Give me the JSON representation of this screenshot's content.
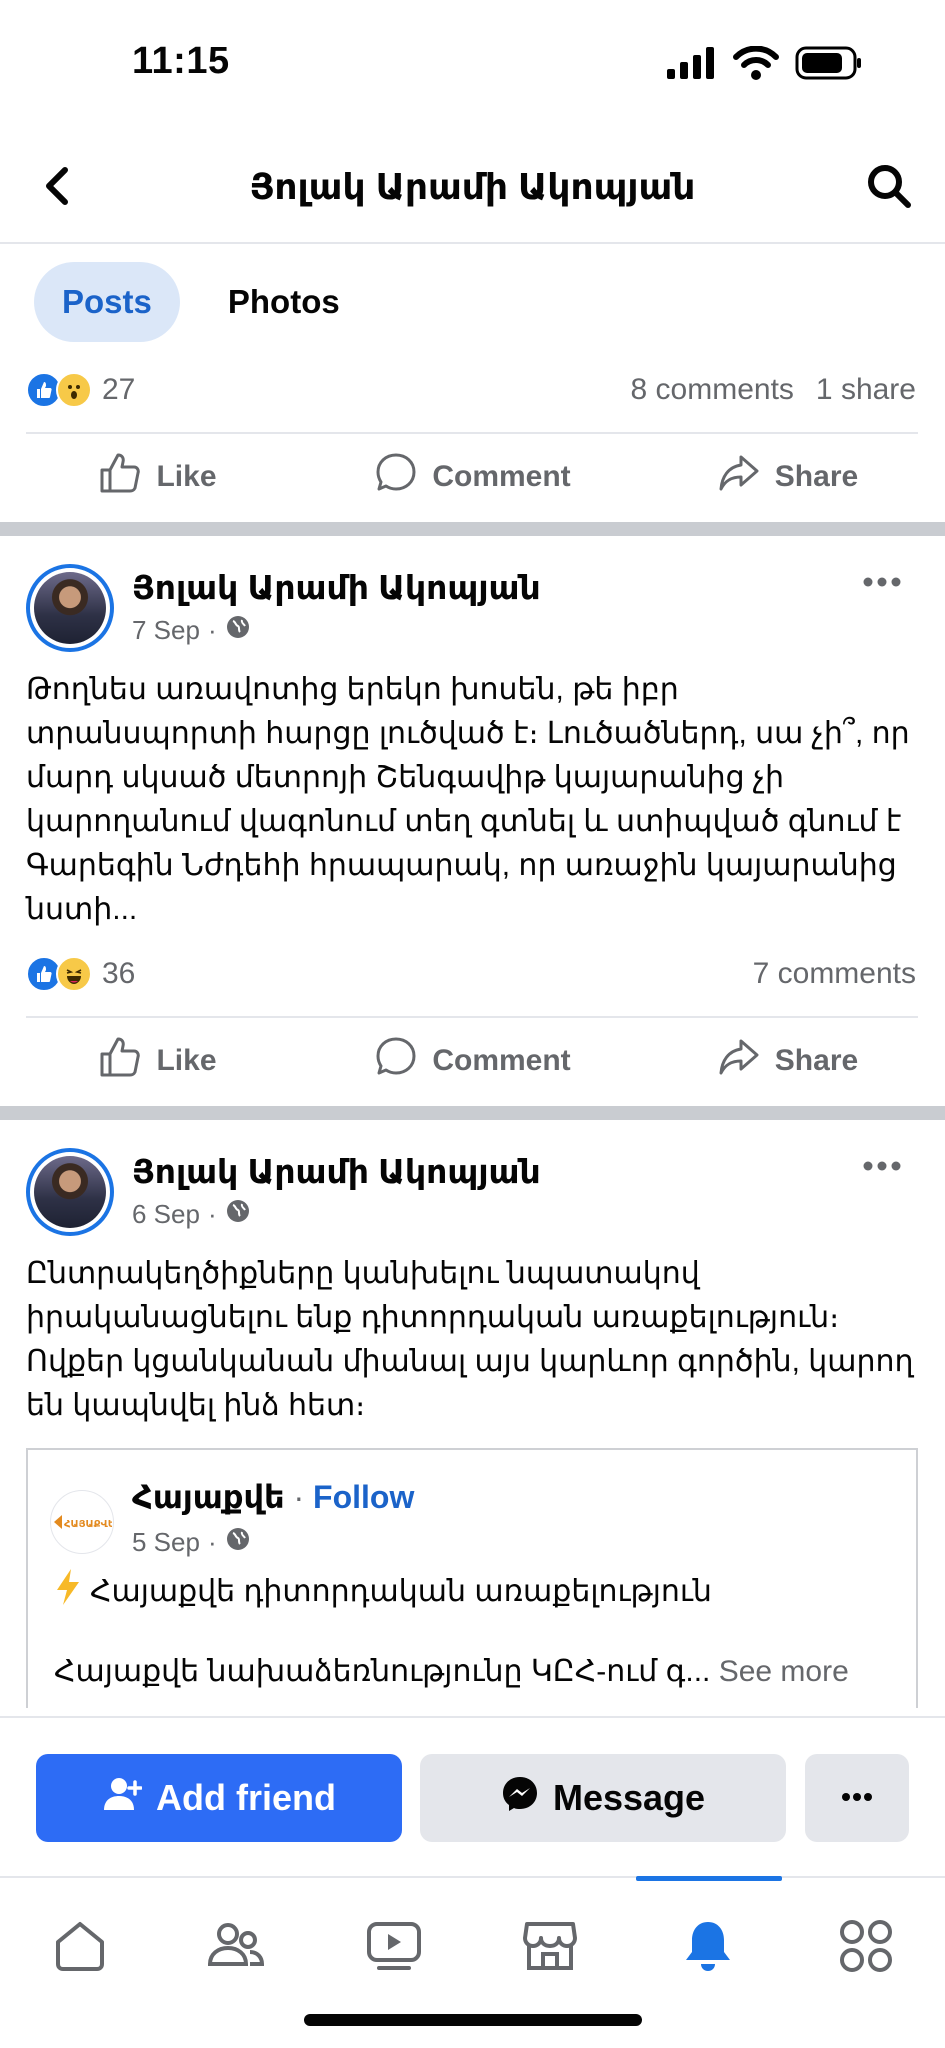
{
  "status_bar": {
    "time": "11:15"
  },
  "header": {
    "title": "Յոլակ Արամի Ակոպյան"
  },
  "tabs": [
    {
      "label": "Posts",
      "active": true
    },
    {
      "label": "Photos",
      "active": false
    }
  ],
  "prev_post": {
    "reaction_count": "27",
    "comments": "8 comments",
    "shares": "1 share"
  },
  "actions": {
    "like": "Like",
    "comment": "Comment",
    "share": "Share"
  },
  "posts": [
    {
      "author": "Յոլակ Արամի Ակոպյան",
      "date": "7 Sep",
      "text": "Թողնես առավոտից երեկո խոսեն, թե իբր տրանսպորտի հարցը լուծված է։ Լուծածներդ, սա չի՞, որ մարդ սկսած մետրոյի Շենգավիթ կայարանից չի կարողանում վագոնում տեղ գտնել և ստիպված գնում է Գարեգին Նժդեհի հրապարակ, որ առաջին կայարանից նստի...",
      "reaction_count": "36",
      "comments": "7 comments"
    },
    {
      "author": "Յոլակ Արամի Ակոպյան",
      "date": "6 Sep",
      "text": "Ընտրակեղծիքները կանխելու նպատակով իրականացնելու ենք դիտորդական առաքելություն։ Ովքեր կցանկանան միանալ այս կարևոր գործին, կարող են կապնվել ինձ հետ։"
    }
  ],
  "shared": {
    "page_name": "Հայաքվե",
    "separator": "·",
    "follow": "Follow",
    "date": "5 Sep",
    "line1": "Հայաքվե դիտորդական առաքելություն",
    "line2": "Հայաքվե նախաձեռնությունը ԿԸՀ-ում գ...",
    "see_more": "See more",
    "logo_text": "ՀԱՅԱՔՎԵ"
  },
  "profile_actions": {
    "add_friend": "Add friend",
    "message": "Message"
  },
  "colors": {
    "accent": "#1b74e4",
    "primary_button": "#2d6cf5",
    "secondary_button": "#e4e6eb",
    "muted_text": "#65676b"
  },
  "icons": {
    "nav": [
      "home-icon",
      "friends-icon",
      "video-icon",
      "marketplace-icon",
      "notifications-icon",
      "menu-icon"
    ]
  }
}
